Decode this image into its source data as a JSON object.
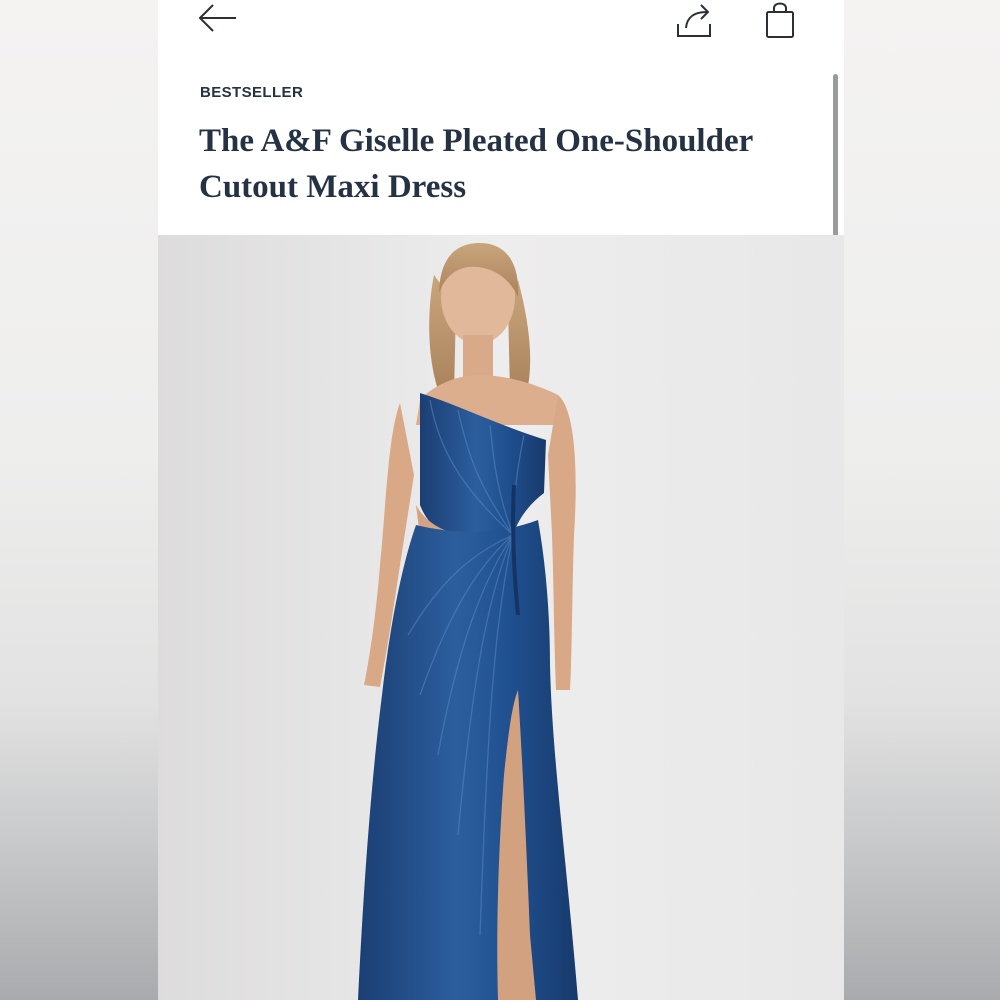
{
  "header": {
    "icons": [
      "back-arrow-icon",
      "share-icon",
      "shopping-bag-icon"
    ]
  },
  "product": {
    "badge": "BESTSELLER",
    "title": "The A&F Giselle Pleated One-Shoulder Cutout Maxi Dress",
    "image_subject": "model-in-navy-one-shoulder-pleated-maxi-dress",
    "dress_color": "#1f4f8f"
  }
}
